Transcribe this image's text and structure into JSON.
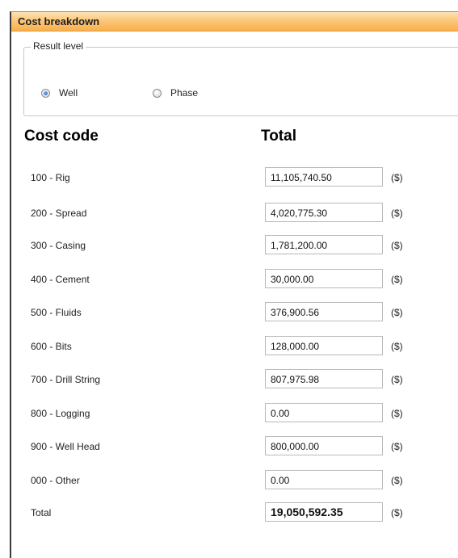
{
  "panel": {
    "title": "Cost breakdown"
  },
  "result_level": {
    "label": "Result level",
    "options": [
      {
        "label": "Well",
        "checked": true
      },
      {
        "label": "Phase",
        "checked": false
      }
    ]
  },
  "table": {
    "headers": {
      "cost_code": "Cost code",
      "total": "Total"
    },
    "unit": "($)",
    "rows": [
      {
        "code": "100 - Rig",
        "value": "11,105,740.50"
      },
      {
        "code": "200 - Spread",
        "value": "4,020,775.30"
      },
      {
        "code": "300 - Casing",
        "value": "1,781,200.00"
      },
      {
        "code": "400 - Cement",
        "value": "30,000.00"
      },
      {
        "code": "500 - Fluids",
        "value": "376,900.56"
      },
      {
        "code": "600 - Bits",
        "value": "128,000.00"
      },
      {
        "code": "700 - Drill String",
        "value": "807,975.98"
      },
      {
        "code": "800 - Logging",
        "value": "0.00"
      },
      {
        "code": "900 - Well Head",
        "value": "800,000.00"
      },
      {
        "code": "000 - Other",
        "value": "0.00"
      }
    ],
    "total": {
      "label": "Total",
      "value": "19,050,592.35"
    }
  }
}
